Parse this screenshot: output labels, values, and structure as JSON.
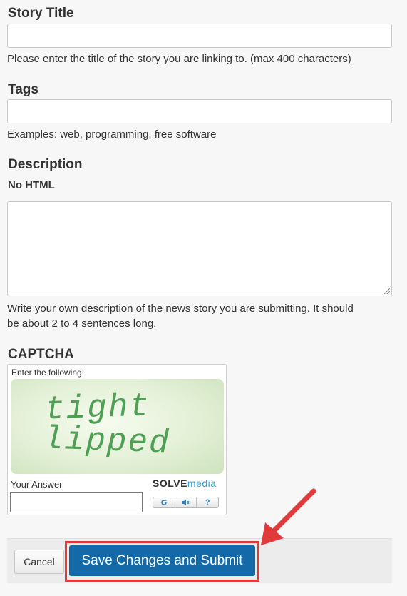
{
  "story_title": {
    "heading": "Story Title",
    "help": "Please enter the title of the story you are linking to. (max 400 characters)"
  },
  "tags": {
    "heading": "Tags",
    "help": "Examples: web, programming, free software"
  },
  "description": {
    "heading": "Description",
    "subheading": "No HTML",
    "help_line1": "Write your own description of the news story you are submitting. It should",
    "help_line2": "be about 2 to 4 sentences long."
  },
  "captcha": {
    "heading": "CAPTCHA",
    "instruction": "Enter the following:",
    "challenge_line1": "tight",
    "challenge_line2": "lipped",
    "answer_label": "Your Answer",
    "brand_part1": "SOLVE",
    "brand_part2": "media",
    "controls": [
      "refresh-icon",
      "audio-icon",
      "help-icon"
    ],
    "help_glyph": "?"
  },
  "actions": {
    "cancel_label": "Cancel",
    "submit_label": "Save Changes and Submit"
  },
  "colors": {
    "submit_bg": "#146aa8",
    "highlight": "#e2393b",
    "captcha_text": "#4f9f55",
    "brand_accent": "#2aa7d8"
  }
}
